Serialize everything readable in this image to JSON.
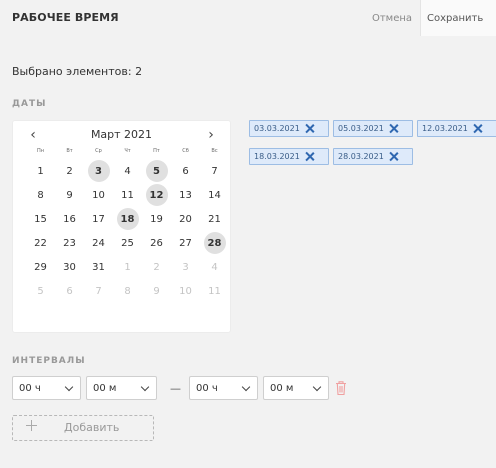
{
  "header": {
    "title": "РАБОЧЕЕ ВРЕМЯ",
    "cancel_label": "Отмена",
    "save_label": "Сохранить"
  },
  "selected_count_text": "Выбрано элементов: 2",
  "dates_section": {
    "label": "ДАТЫ"
  },
  "calendar": {
    "month_label": "Март 2021",
    "prev_icon": "chevron-left-icon",
    "next_icon": "chevron-right-icon",
    "weekdays": [
      "Пн",
      "Вт",
      "Ср",
      "Чт",
      "Пт",
      "Сб",
      "Вс"
    ],
    "days": [
      {
        "n": "1",
        "other": false,
        "sel": false
      },
      {
        "n": "2",
        "other": false,
        "sel": false
      },
      {
        "n": "3",
        "other": false,
        "sel": true
      },
      {
        "n": "4",
        "other": false,
        "sel": false
      },
      {
        "n": "5",
        "other": false,
        "sel": true
      },
      {
        "n": "6",
        "other": false,
        "sel": false
      },
      {
        "n": "7",
        "other": false,
        "sel": false
      },
      {
        "n": "8",
        "other": false,
        "sel": false
      },
      {
        "n": "9",
        "other": false,
        "sel": false
      },
      {
        "n": "10",
        "other": false,
        "sel": false
      },
      {
        "n": "11",
        "other": false,
        "sel": false
      },
      {
        "n": "12",
        "other": false,
        "sel": true
      },
      {
        "n": "13",
        "other": false,
        "sel": false
      },
      {
        "n": "14",
        "other": false,
        "sel": false
      },
      {
        "n": "15",
        "other": false,
        "sel": false
      },
      {
        "n": "16",
        "other": false,
        "sel": false
      },
      {
        "n": "17",
        "other": false,
        "sel": false
      },
      {
        "n": "18",
        "other": false,
        "sel": true
      },
      {
        "n": "19",
        "other": false,
        "sel": false
      },
      {
        "n": "20",
        "other": false,
        "sel": false
      },
      {
        "n": "21",
        "other": false,
        "sel": false
      },
      {
        "n": "22",
        "other": false,
        "sel": false
      },
      {
        "n": "23",
        "other": false,
        "sel": false
      },
      {
        "n": "24",
        "other": false,
        "sel": false
      },
      {
        "n": "25",
        "other": false,
        "sel": false
      },
      {
        "n": "26",
        "other": false,
        "sel": false
      },
      {
        "n": "27",
        "other": false,
        "sel": false
      },
      {
        "n": "28",
        "other": false,
        "sel": true
      },
      {
        "n": "29",
        "other": false,
        "sel": false
      },
      {
        "n": "30",
        "other": false,
        "sel": false
      },
      {
        "n": "31",
        "other": false,
        "sel": false
      },
      {
        "n": "1",
        "other": true,
        "sel": false
      },
      {
        "n": "2",
        "other": true,
        "sel": false
      },
      {
        "n": "3",
        "other": true,
        "sel": false
      },
      {
        "n": "4",
        "other": true,
        "sel": false
      },
      {
        "n": "5",
        "other": true,
        "sel": false
      },
      {
        "n": "6",
        "other": true,
        "sel": false
      },
      {
        "n": "7",
        "other": true,
        "sel": false
      },
      {
        "n": "8",
        "other": true,
        "sel": false
      },
      {
        "n": "9",
        "other": true,
        "sel": false
      },
      {
        "n": "10",
        "other": true,
        "sel": false
      },
      {
        "n": "11",
        "other": true,
        "sel": false
      }
    ]
  },
  "selected_dates": [
    "03.03.2021",
    "05.03.2021",
    "12.03.2021",
    "18.03.2021",
    "28.03.2021"
  ],
  "intervals_section": {
    "label": "ИНТЕРВАЛЫ",
    "from_hours": "00 ч",
    "from_minutes": "00 м",
    "separator": "—",
    "to_hours": "00 ч",
    "to_minutes": "00 м",
    "delete_icon": "trash-icon",
    "add_label": "Добавить",
    "add_icon": "plus-icon"
  },
  "colors": {
    "chip_bg": "#deeafa",
    "chip_border": "#9dbde4",
    "chip_x": "#2f67b0",
    "trash": "#f0a0a0",
    "selected_day_bg": "#e0e0e0"
  }
}
